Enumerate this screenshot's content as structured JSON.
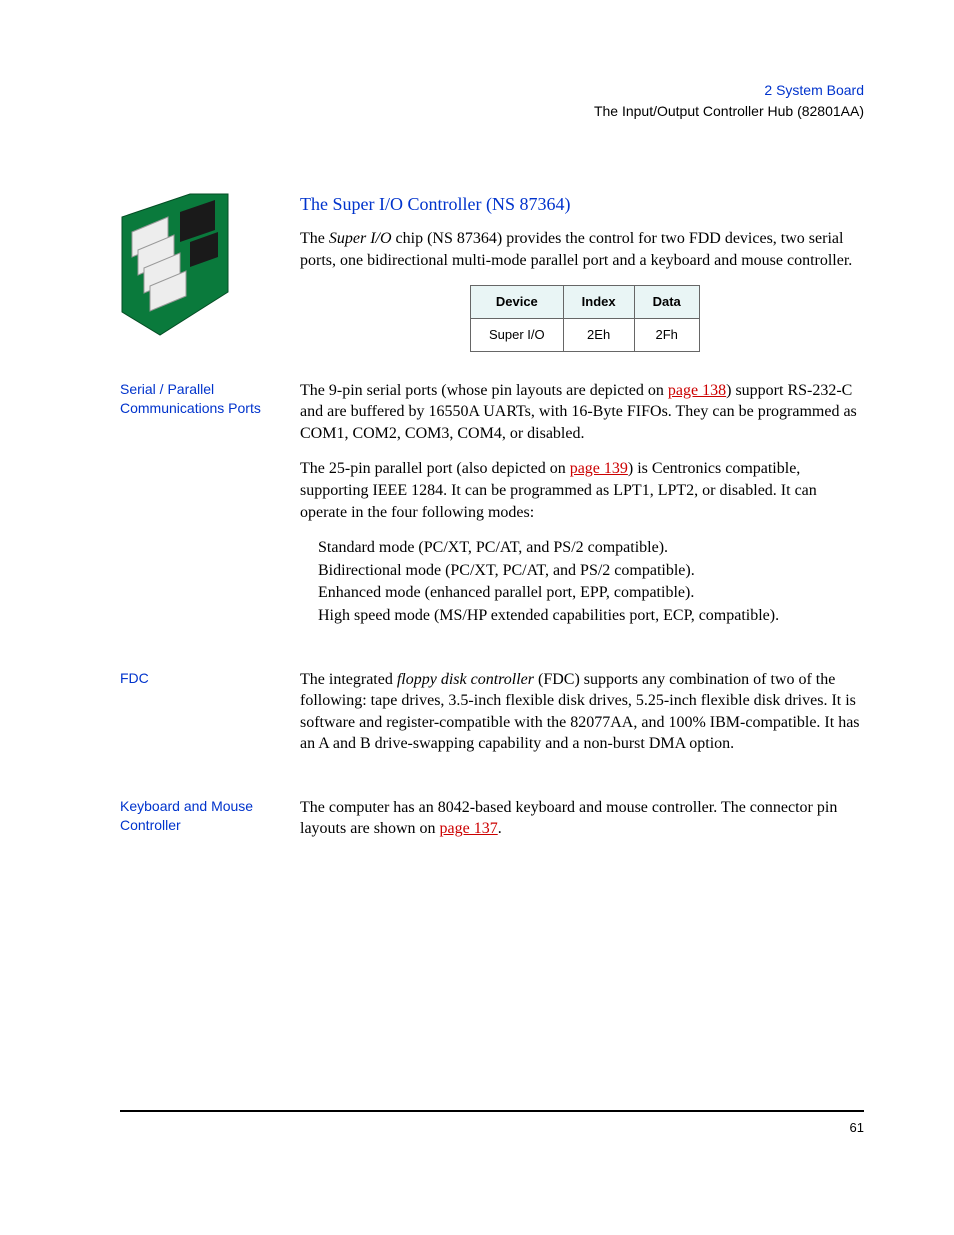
{
  "header": {
    "chapter": "2  System Board",
    "section": "The Input/Output Controller Hub (82801AA)"
  },
  "superio": {
    "title": "The Super I/O Controller (NS 87364)",
    "intro_pre": "The ",
    "intro_em": "Super I/O",
    "intro_post": " chip (NS 87364) provides the control for two FDD devices, two serial ports, one bidirectional multi-mode parallel port and a keyboard and mouse controller.",
    "table": {
      "h1": "Device",
      "h2": "Index",
      "h3": "Data",
      "r1c1": "Super I/O",
      "r1c2": "2Eh",
      "r1c3": "2Fh"
    }
  },
  "serial": {
    "label": "Serial / Parallel Communications Ports",
    "p1_a": "The 9-pin serial ports (whose pin layouts are depicted on ",
    "p1_link": "page 138",
    "p1_b": ") support RS-232-C and are buffered by 16550A UARTs, with 16-Byte FIFOs. They can be programmed as COM1, COM2, COM3, COM4, or disabled.",
    "p2_a": "The 25-pin parallel port (also depicted on ",
    "p2_link": "page 139",
    "p2_b": ") is Centronics compatible, supporting IEEE 1284. It can be programmed as LPT1, LPT2, or disabled. It can operate in the four following modes:",
    "modes": {
      "m1": "Standard mode (PC/XT, PC/AT, and PS/2 compatible).",
      "m2": "Bidirectional mode (PC/XT, PC/AT, and PS/2 compatible).",
      "m3": "Enhanced mode (enhanced parallel port, EPP, compatible).",
      "m4": "High speed mode (MS/HP extended capabilities port, ECP, compatible)."
    }
  },
  "fdc": {
    "label": "FDC",
    "p_a": "The integrated ",
    "p_em": "floppy disk controller",
    "p_b": " (FDC) supports any combination of two of the following: tape drives, 3.5-inch flexible disk drives, 5.25-inch flexible disk drives. It is software and register-compatible with the 82077AA, and 100% IBM-compatible. It has an A and B drive-swapping capability and a non-burst DMA option."
  },
  "kbm": {
    "label": "Keyboard and Mouse Controller",
    "p_a": "The computer has an 8042-based keyboard and mouse controller. The connector pin layouts are shown on ",
    "p_link": "page 137",
    "p_b": "."
  },
  "page_number": "61"
}
